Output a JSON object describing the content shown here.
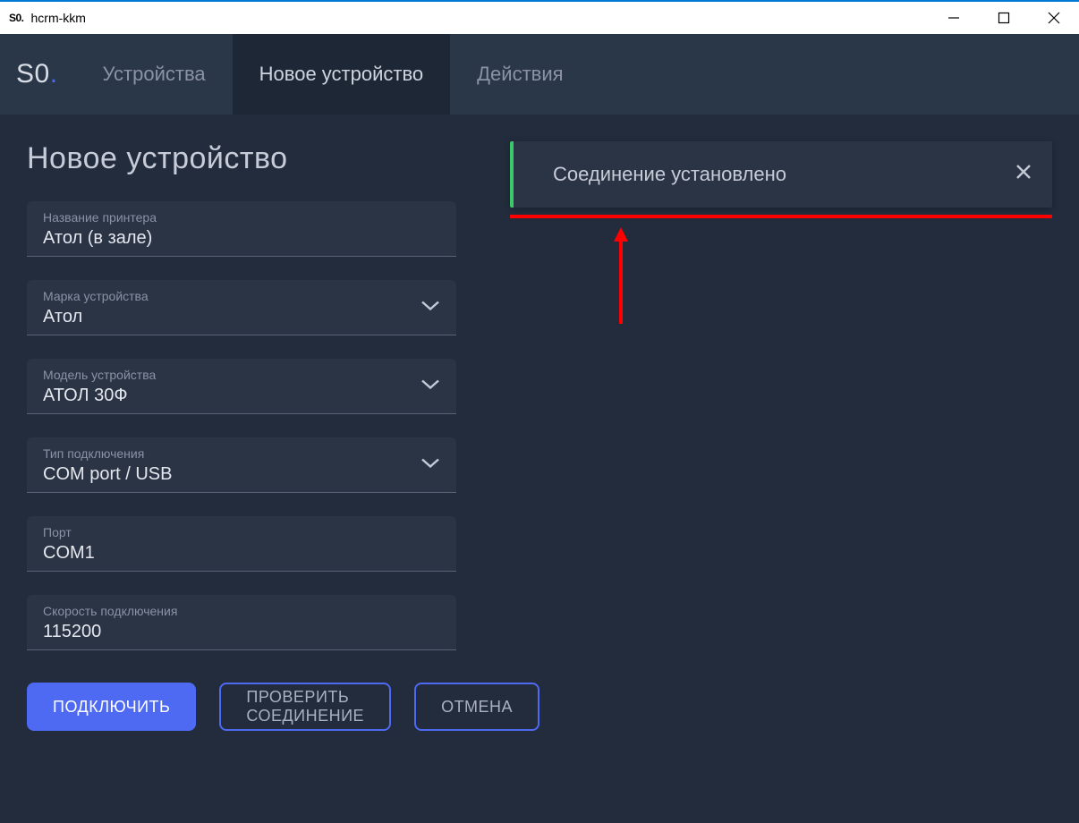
{
  "window": {
    "appicon_text": "S0.",
    "title": "hcrm-kkm"
  },
  "brand": {
    "text": "S0",
    "dot": "."
  },
  "tabs": [
    {
      "label": "Устройства",
      "active": false
    },
    {
      "label": "Новое устройство",
      "active": true
    },
    {
      "label": "Действия",
      "active": false
    }
  ],
  "page": {
    "title": "Новое устройство"
  },
  "form": {
    "printer_name": {
      "label": "Название принтера",
      "value": "Атол (в зале)"
    },
    "brand": {
      "label": "Марка устройства",
      "value": "Атол"
    },
    "model": {
      "label": "Модель устройства",
      "value": "АТОЛ 30Ф"
    },
    "conn_type": {
      "label": "Тип подключения",
      "value": "COM port / USB"
    },
    "port": {
      "label": "Порт",
      "value": "COM1"
    },
    "speed": {
      "label": "Скорость подключения",
      "value": "115200"
    }
  },
  "buttons": {
    "connect": "ПОДКЛЮЧИТЬ",
    "test": "ПРОВЕРИТЬ СОЕДИНЕНИЕ",
    "cancel": "ОТМЕНА"
  },
  "toast": {
    "message": "Соединение установлено"
  }
}
